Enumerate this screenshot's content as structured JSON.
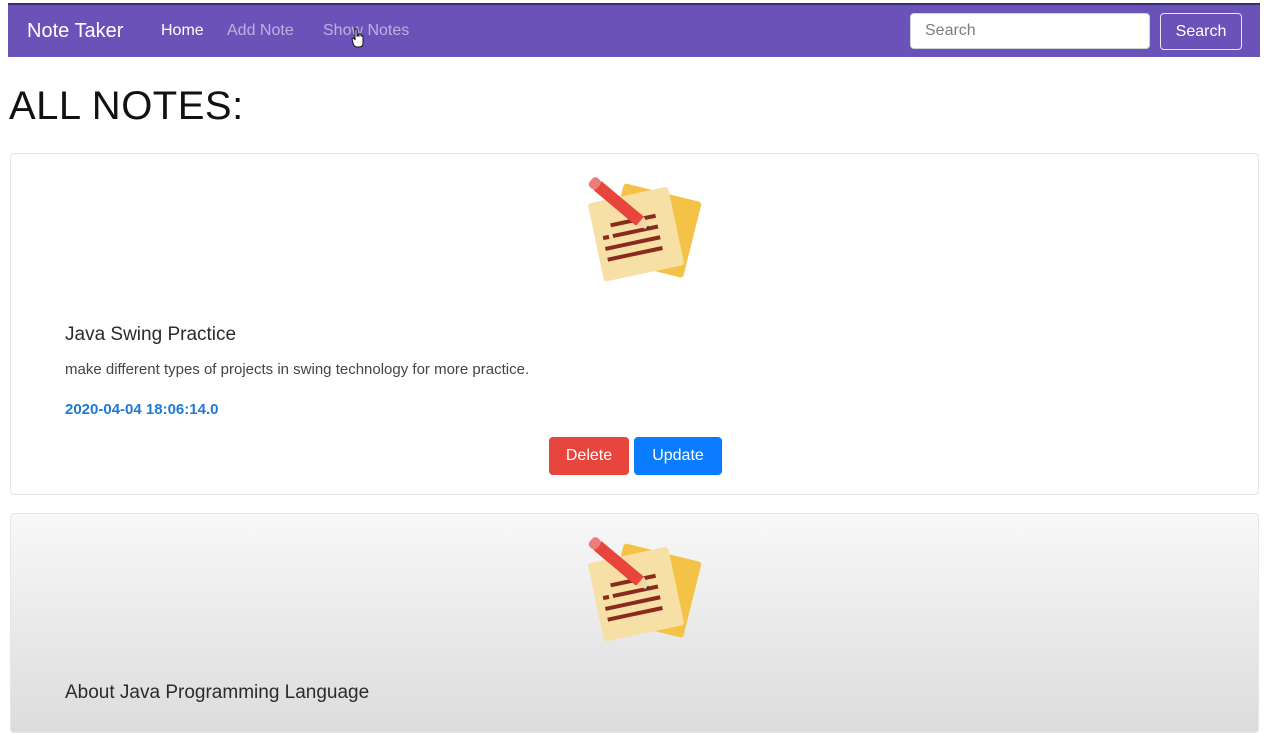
{
  "navbar": {
    "brand": "Note Taker",
    "links": [
      {
        "label": "Home"
      },
      {
        "label": "Add Note"
      },
      {
        "label": "Show Notes"
      }
    ],
    "search_placeholder": "Search",
    "search_button": "Search",
    "background_color": "#6a52b9"
  },
  "page": {
    "title": "ALL NOTES:"
  },
  "notes": [
    {
      "title": "Java Swing Practice",
      "content": "make different types of projects in swing technology for more practice.",
      "date": "2020-04-04 18:06:14.0",
      "icon": "note-icon",
      "delete_label": "Delete",
      "update_label": "Update"
    },
    {
      "title": "About Java Programming Language",
      "icon": "note-icon"
    }
  ],
  "colors": {
    "delete": "#e8453c",
    "update": "#0b7bff",
    "date": "#1f7ad6"
  }
}
